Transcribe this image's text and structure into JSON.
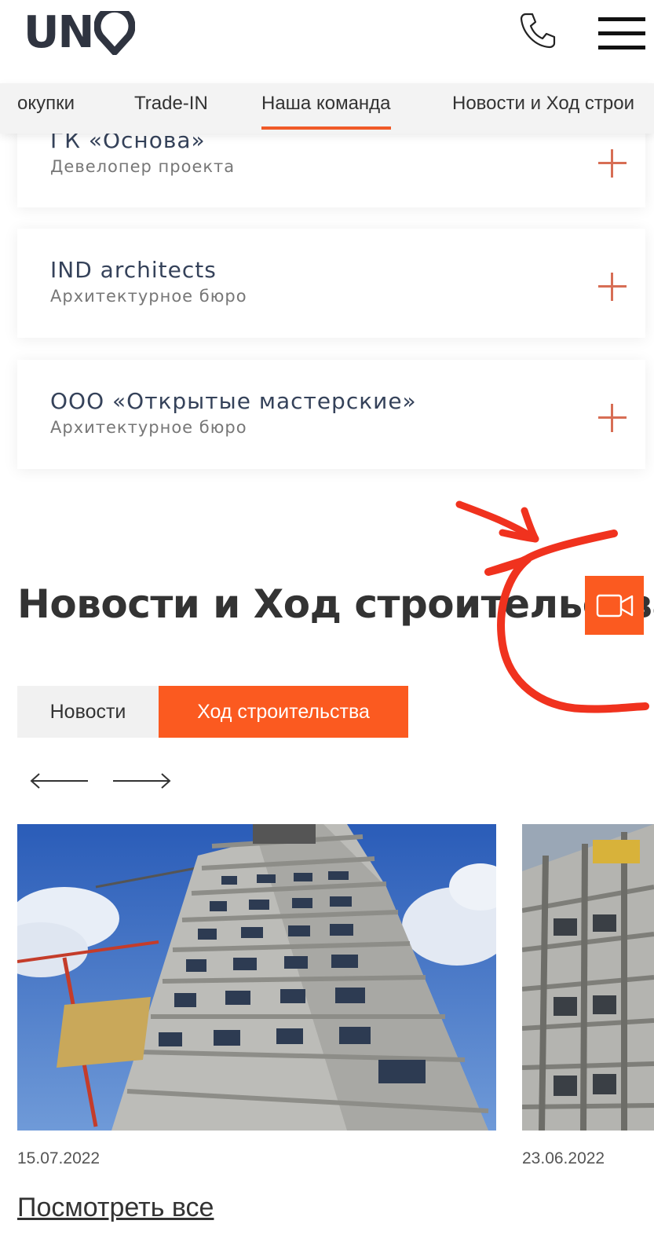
{
  "header": {
    "logo_text": "UN",
    "logo_letter": "O"
  },
  "nav": {
    "tabs": [
      {
        "label": "окупки",
        "active": false
      },
      {
        "label": "Trade-IN",
        "active": false
      },
      {
        "label": "Наша команда",
        "active": true
      },
      {
        "label": "Новости и Ход строи",
        "active": false
      }
    ]
  },
  "team": [
    {
      "name": "ГК «Основа»",
      "role": "Девелопер проекта"
    },
    {
      "name": "IND architects",
      "role": "Архитектурное бюро"
    },
    {
      "name": "ООО «Открытые мастерские»",
      "role": "Архитектурное бюро"
    }
  ],
  "news": {
    "title": "Новости и Ход строительства",
    "switch": {
      "news_label": "Новости",
      "construction_label": "Ход строительства",
      "active": "construction"
    },
    "items": [
      {
        "date": "15.07.2022"
      },
      {
        "date": "23.06.2022"
      }
    ],
    "view_all": "Посмотреть все"
  },
  "colors": {
    "accent": "#fb5a20",
    "plus": "#d76e55",
    "text_dark": "#35425a",
    "annotation_red": "#f0321e"
  }
}
